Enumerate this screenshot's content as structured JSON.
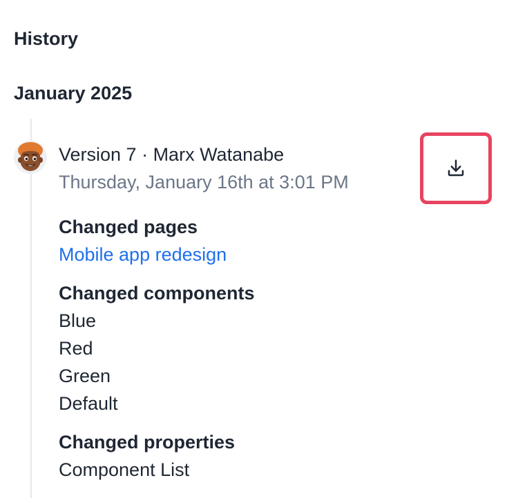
{
  "panel": {
    "title": "History"
  },
  "history": {
    "month": "January 2025",
    "entry": {
      "title": "Version 7 · Marx Watanabe",
      "date": "Thursday, January 16th at 3:01 PM",
      "avatar_icon": "memoji-avatar-icon",
      "download_icon": "download-icon",
      "highlight_color": "#e8435f",
      "changed_pages": {
        "label": "Changed pages",
        "items": [
          "Mobile app redesign"
        ]
      },
      "changed_components": {
        "label": "Changed components",
        "items": [
          "Blue",
          "Red",
          "Green",
          "Default"
        ]
      },
      "changed_properties": {
        "label": "Changed properties",
        "items": [
          "Component List"
        ]
      }
    }
  },
  "colors": {
    "text": "#1f2733",
    "muted": "#6b7688",
    "link": "#1f6feb"
  }
}
